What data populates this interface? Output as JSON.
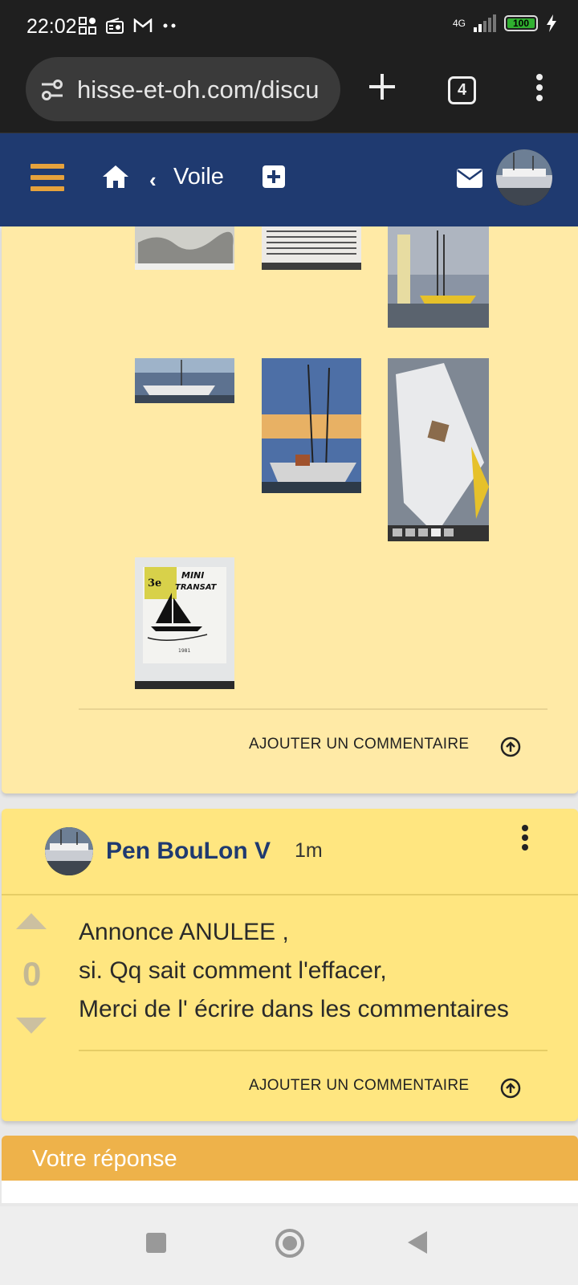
{
  "status_bar": {
    "time": "22:02",
    "network": "4G",
    "battery": "100"
  },
  "browser": {
    "url": "hisse-et-oh.com/discu",
    "tab_count": "4"
  },
  "site_header": {
    "breadcrumb": "Voile"
  },
  "gallery": {
    "images": [
      {
        "alt": "old black and white photo of boats"
      },
      {
        "alt": "printed results sheet"
      },
      {
        "alt": "sailboat at pontoon at sunset"
      },
      {
        "alt": "boats moored in harbour"
      },
      {
        "alt": "sailboat masts against sunset sky"
      },
      {
        "alt": "white sailboat deck top view"
      },
      {
        "alt": "3e Mini Transat 1981 booklet cover"
      }
    ],
    "booklet_text": {
      "edition": "3e",
      "line1": "MINI",
      "line2": "TRANSAT",
      "year": "1981"
    },
    "comment_link": "AJOUTER UN COMMENTAIRE"
  },
  "post": {
    "author": "Pen BouLon V",
    "time": "1m",
    "votes": "0",
    "lines": [
      "Annonce ANULEE ,",
      "si. Qq sait comment l'effacer,",
      "Merci de l' écrire dans les commentaires"
    ],
    "comment_link": "AJOUTER UN COMMENTAIRE"
  },
  "reply": {
    "title": "Votre réponse"
  }
}
